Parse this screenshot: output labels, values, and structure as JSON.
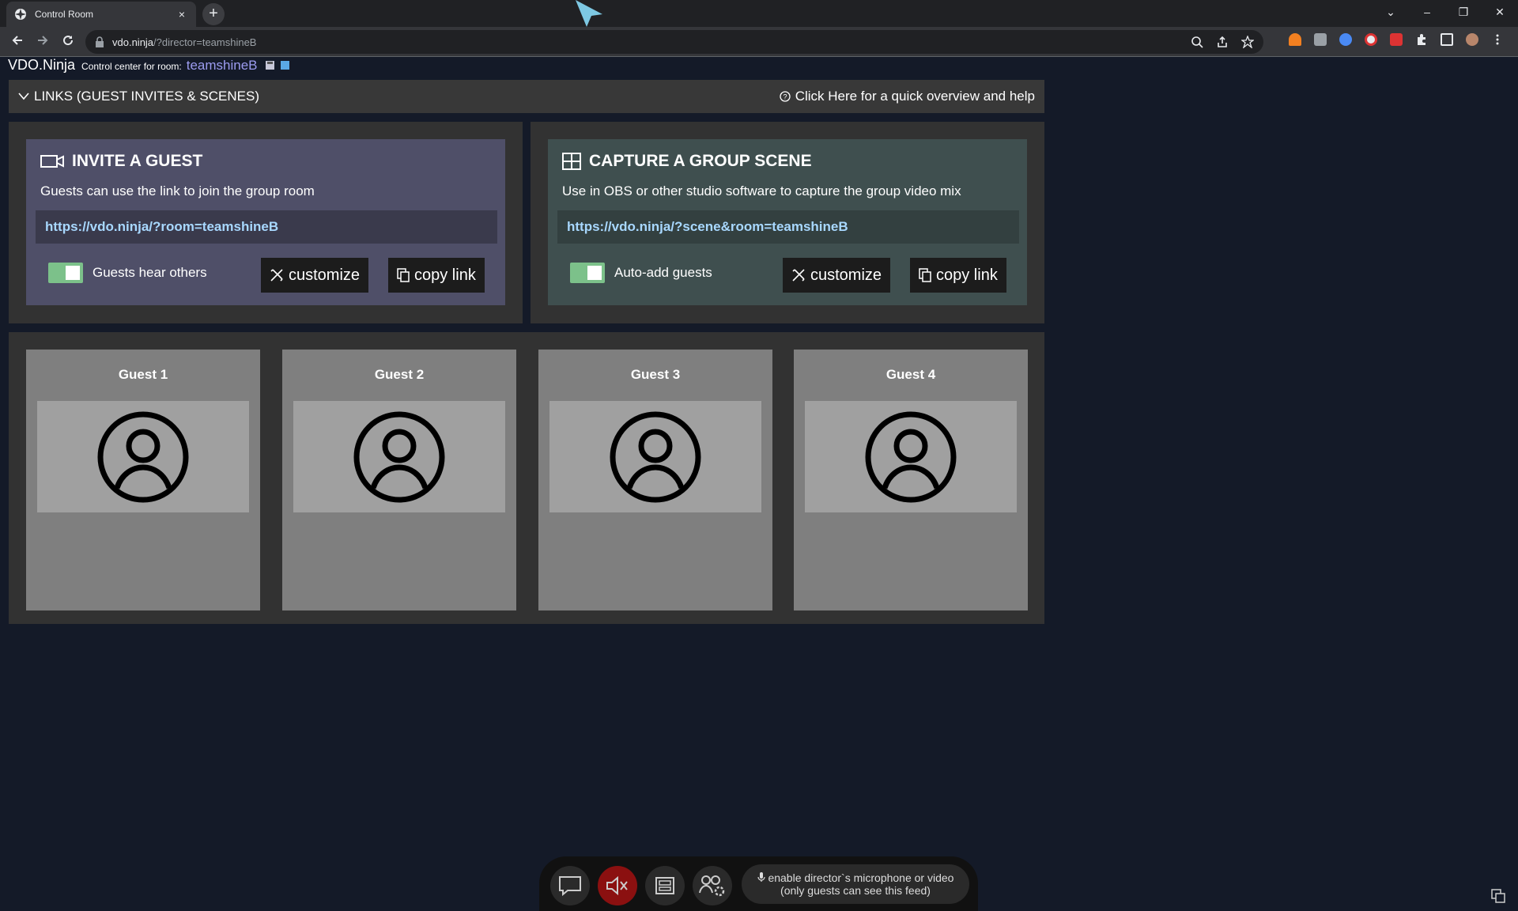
{
  "browser": {
    "tab_title": "Control Room",
    "tab_close": "×",
    "new_tab": "+",
    "url_host": "vdo.ninja",
    "url_path": "/?director=teamshineB",
    "win_controls": [
      "⌄",
      "–",
      "❐",
      "✕"
    ]
  },
  "header": {
    "brand": "VDO.Ninja",
    "control_label": "Control center for room:",
    "room_name": "teamshineB"
  },
  "links_bar": {
    "label": "LINKS (GUEST INVITES & SCENES)",
    "help": "Click Here for a quick overview and help"
  },
  "invite": {
    "title": "INVITE A GUEST",
    "description": "Guests can use the link to join the group room",
    "url": "https://vdo.ninja/?room=teamshineB",
    "toggle_label": "Guests hear others",
    "customize": "customize",
    "copy_link": "copy link",
    "bg_color": "#4f4f68"
  },
  "scene": {
    "title": "CAPTURE A GROUP SCENE",
    "description": "Use in OBS or other studio software to capture the group video mix",
    "url": "https://vdo.ninja/?scene&room=teamshineB",
    "toggle_label": "Auto-add guests",
    "customize": "customize",
    "copy_link": "copy link",
    "bg_color": "#3f4f4f"
  },
  "guests": [
    {
      "name": "Guest 1"
    },
    {
      "name": "Guest 2"
    },
    {
      "name": "Guest 3"
    },
    {
      "name": "Guest 4"
    }
  ],
  "control_bar": {
    "mic_note_line1": "enable director`s microphone or video",
    "mic_note_line2": "(only guests can see this feed)"
  }
}
